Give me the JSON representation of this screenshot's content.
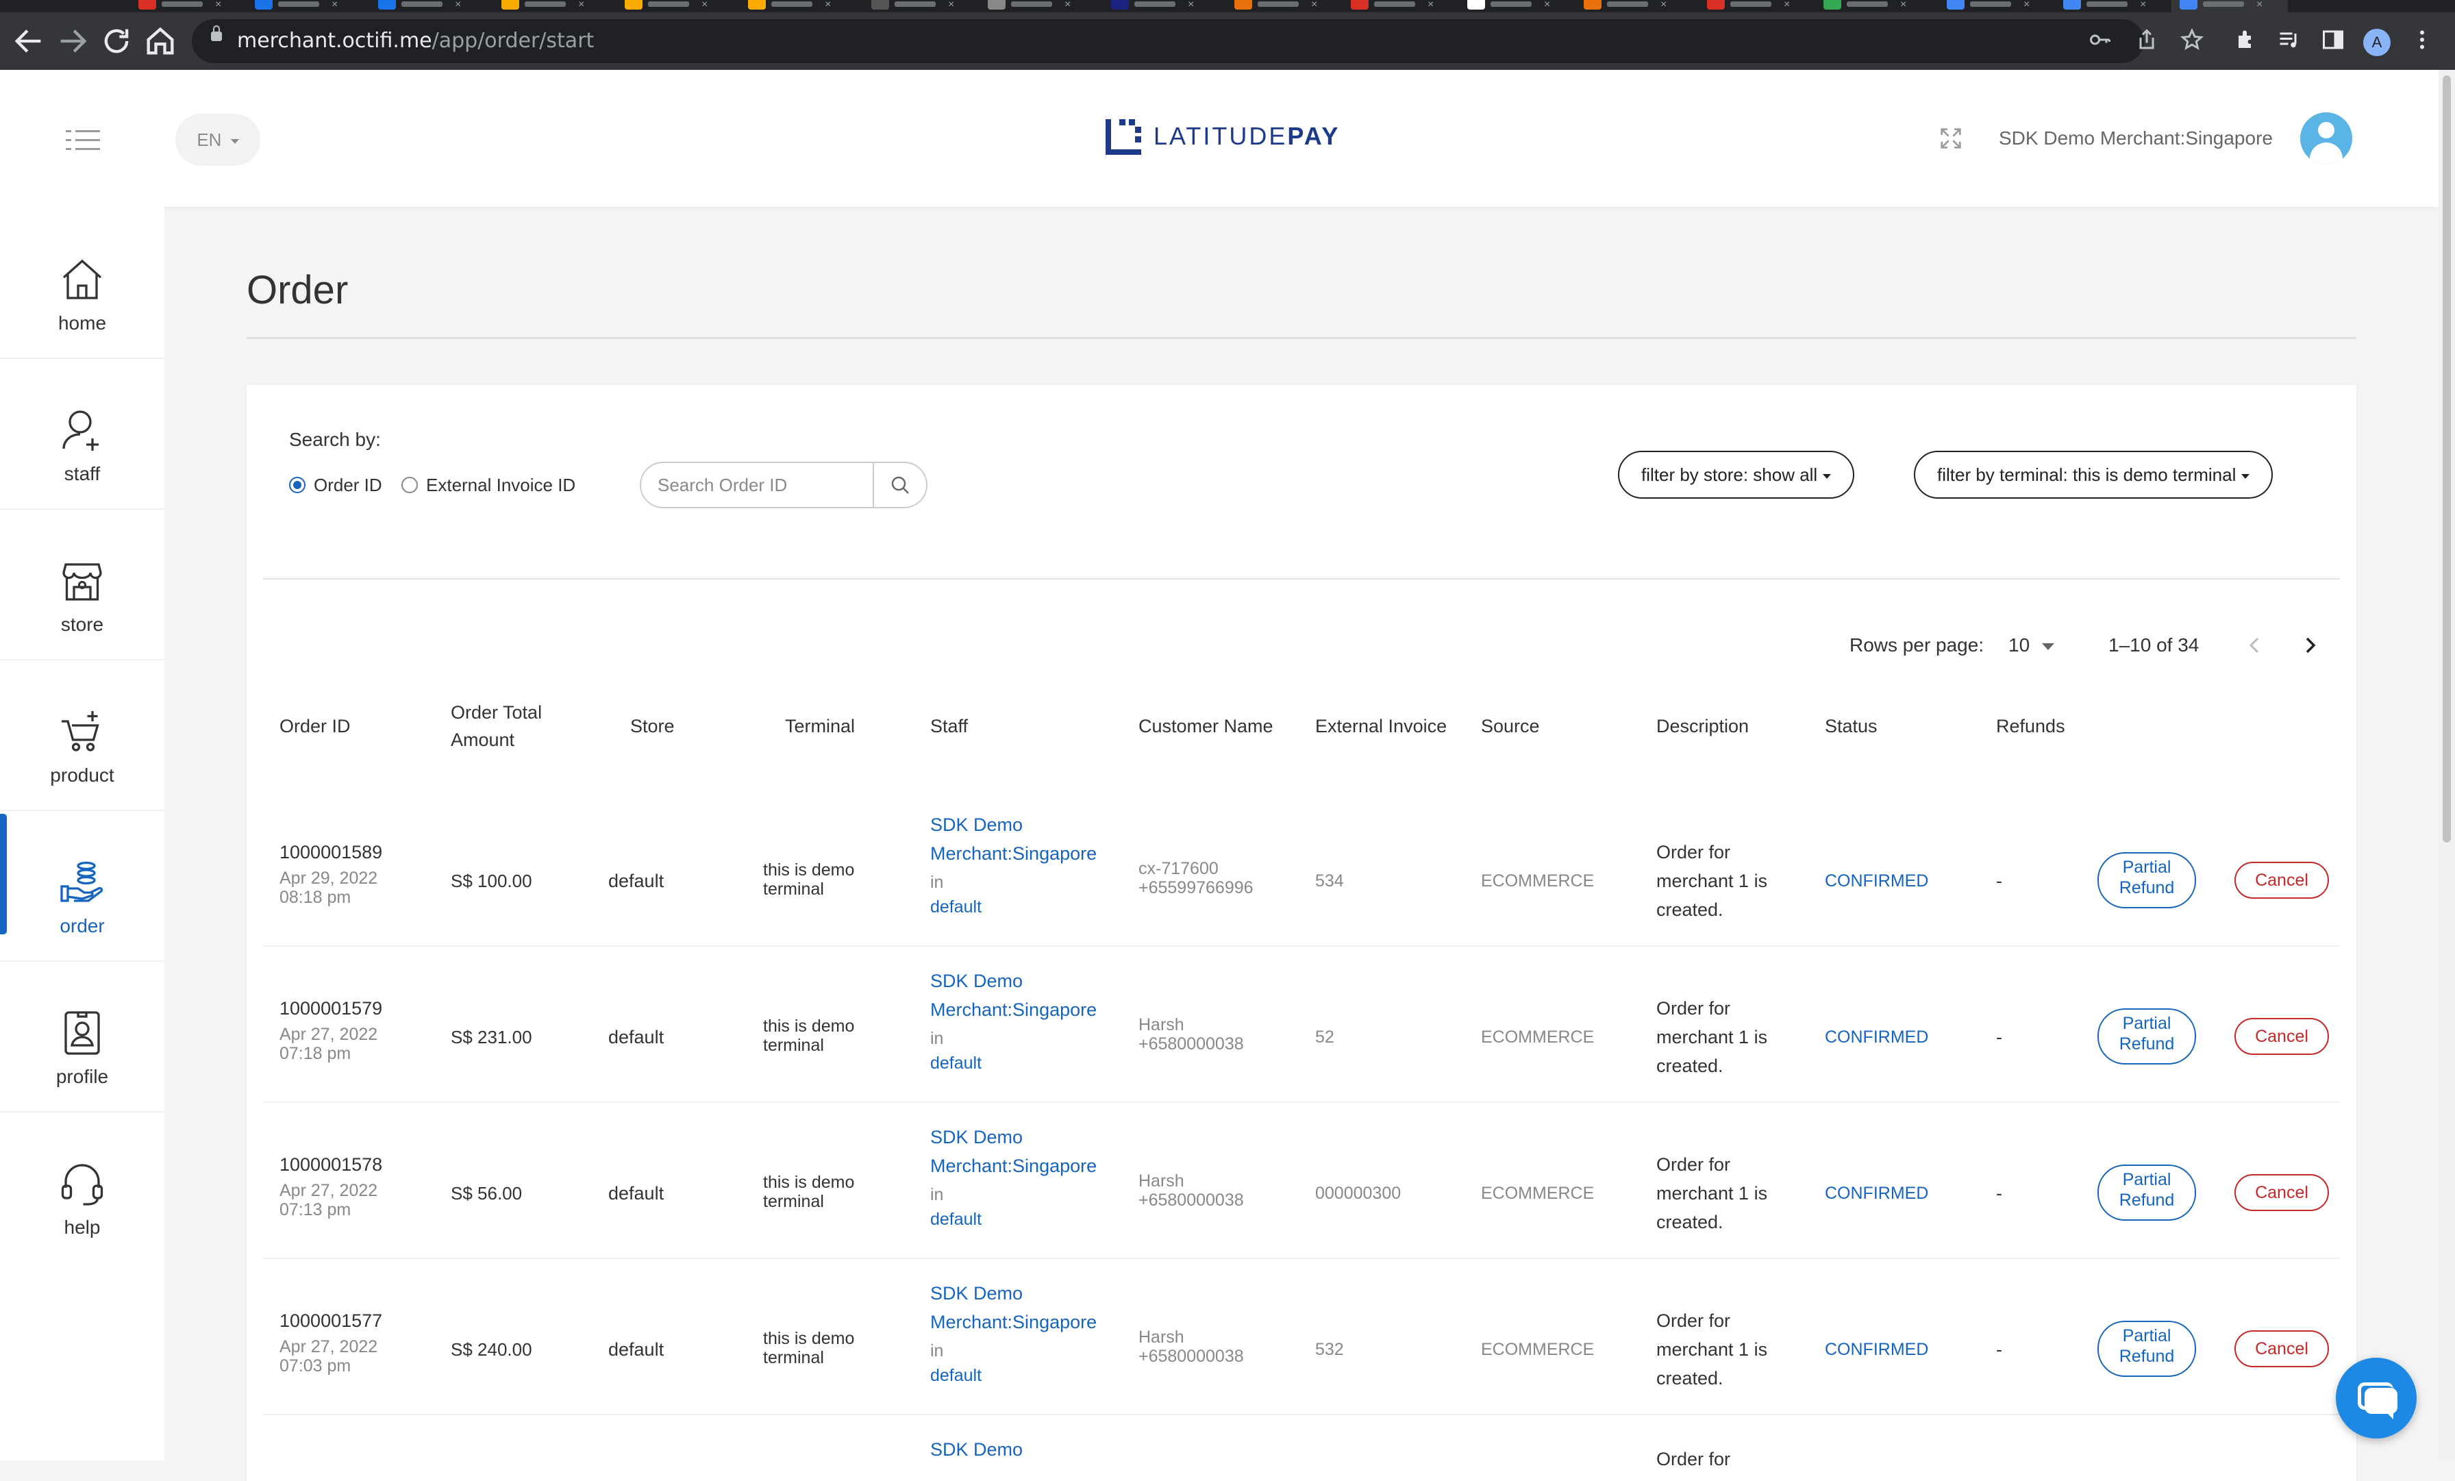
{
  "browser": {
    "url_host": "merchant.octifi.me",
    "url_path": "/app/order/start",
    "profile_initial": "A"
  },
  "header": {
    "language": "EN",
    "logo_text_light": "LATITUDE",
    "logo_text_bold": "PAY",
    "merchant_name": "SDK Demo Merchant:Singapore"
  },
  "sidebar": {
    "items": [
      {
        "label": "home",
        "icon": "home-icon"
      },
      {
        "label": "staff",
        "icon": "staff-icon"
      },
      {
        "label": "store",
        "icon": "store-icon"
      },
      {
        "label": "product",
        "icon": "cart-icon"
      },
      {
        "label": "order",
        "icon": "order-icon"
      },
      {
        "label": "profile",
        "icon": "profile-icon"
      },
      {
        "label": "help",
        "icon": "headset-icon"
      }
    ]
  },
  "page": {
    "title": "Order"
  },
  "search": {
    "label": "Search by:",
    "option_order_id": "Order ID",
    "option_external_invoice": "External Invoice ID",
    "placeholder": "Search Order ID"
  },
  "filters": {
    "store": "filter by store: show all",
    "terminal": "filter by terminal: this is demo terminal"
  },
  "pagination": {
    "rows_label": "Rows per page:",
    "rows_value": "10",
    "range": "1–10 of 34"
  },
  "table": {
    "headers": {
      "order_id": "Order ID",
      "total_1": "Order Total",
      "total_2": "Amount",
      "store": "Store",
      "terminal": "Terminal",
      "staff": "Staff",
      "customer": "Customer Name",
      "invoice": "External Invoice",
      "source": "Source",
      "description": "Description",
      "status": "Status",
      "refunds": "Refunds"
    },
    "rows": [
      {
        "id": "1000001589",
        "date": "Apr 29, 2022",
        "time": "08:18 pm",
        "amount": "S$ 100.00",
        "store": "default",
        "terminal_1": "this is demo",
        "terminal_2": "terminal",
        "staff_1": "SDK Demo",
        "staff_2": "Merchant:Singapore",
        "staff_in": "in",
        "staff_store": "default",
        "customer_1": "cx-717600",
        "customer_2": "+65599766996",
        "invoice": "534",
        "source": "ECOMMERCE",
        "desc_1": "Order for",
        "desc_2": "merchant 1 is",
        "desc_3": "created.",
        "status": "CONFIRMED",
        "refunds": "-",
        "refund_btn_1": "Partial",
        "refund_btn_2": "Refund",
        "cancel_btn": "Cancel"
      },
      {
        "id": "1000001579",
        "date": "Apr 27, 2022",
        "time": "07:18 pm",
        "amount": "S$ 231.00",
        "store": "default",
        "terminal_1": "this is demo",
        "terminal_2": "terminal",
        "staff_1": "SDK Demo",
        "staff_2": "Merchant:Singapore",
        "staff_in": "in",
        "staff_store": "default",
        "customer_1": "Harsh",
        "customer_2": "+6580000038",
        "invoice": "52",
        "source": "ECOMMERCE",
        "desc_1": "Order for",
        "desc_2": "merchant 1 is",
        "desc_3": "created.",
        "status": "CONFIRMED",
        "refunds": "-",
        "refund_btn_1": "Partial",
        "refund_btn_2": "Refund",
        "cancel_btn": "Cancel"
      },
      {
        "id": "1000001578",
        "date": "Apr 27, 2022",
        "time": "07:13 pm",
        "amount": "S$ 56.00",
        "store": "default",
        "terminal_1": "this is demo",
        "terminal_2": "terminal",
        "staff_1": "SDK Demo",
        "staff_2": "Merchant:Singapore",
        "staff_in": "in",
        "staff_store": "default",
        "customer_1": "Harsh",
        "customer_2": "+6580000038",
        "invoice": "000000300",
        "source": "ECOMMERCE",
        "desc_1": "Order for",
        "desc_2": "merchant 1 is",
        "desc_3": "created.",
        "status": "CONFIRMED",
        "refunds": "-",
        "refund_btn_1": "Partial",
        "refund_btn_2": "Refund",
        "cancel_btn": "Cancel"
      },
      {
        "id": "1000001577",
        "date": "Apr 27, 2022",
        "time": "07:03 pm",
        "amount": "S$ 240.00",
        "store": "default",
        "terminal_1": "this is demo",
        "terminal_2": "terminal",
        "staff_1": "SDK Demo",
        "staff_2": "Merchant:Singapore",
        "staff_in": "in",
        "staff_store": "default",
        "customer_1": "Harsh",
        "customer_2": "+6580000038",
        "invoice": "532",
        "source": "ECOMMERCE",
        "desc_1": "Order for",
        "desc_2": "merchant 1 is",
        "desc_3": "created.",
        "status": "CONFIRMED",
        "refunds": "-",
        "refund_btn_1": "Partial",
        "refund_btn_2": "Refund",
        "cancel_btn": "Cancel"
      }
    ],
    "partial_row": {
      "staff_1": "SDK Demo",
      "desc_1": "Order for"
    }
  },
  "colors": {
    "accent": "#1565c0",
    "danger": "#c62828",
    "brand": "#1d3a8a"
  }
}
